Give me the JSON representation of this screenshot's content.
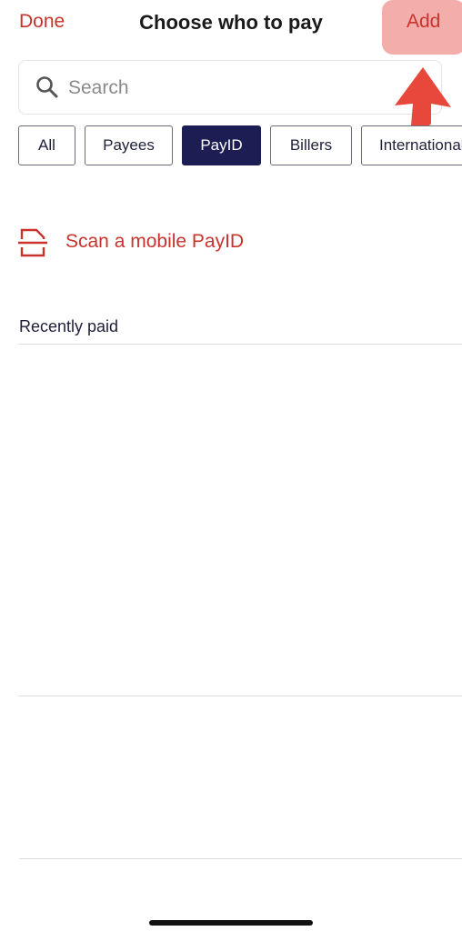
{
  "header": {
    "done_label": "Done",
    "title": "Choose who to pay",
    "add_label": "Add"
  },
  "search": {
    "placeholder": "Search",
    "value": ""
  },
  "filters": [
    {
      "label": "All",
      "active": false
    },
    {
      "label": "Payees",
      "active": false
    },
    {
      "label": "PayID",
      "active": true
    },
    {
      "label": "Billers",
      "active": false
    },
    {
      "label": "International",
      "active": false
    }
  ],
  "scan": {
    "label": "Scan a mobile PayID",
    "icon": "scan-icon"
  },
  "recent": {
    "title": "Recently paid"
  },
  "colors": {
    "accent": "#c8332b",
    "active_chip": "#1c1d52",
    "text": "#1f1f3a",
    "annotation": "#e8483c"
  }
}
